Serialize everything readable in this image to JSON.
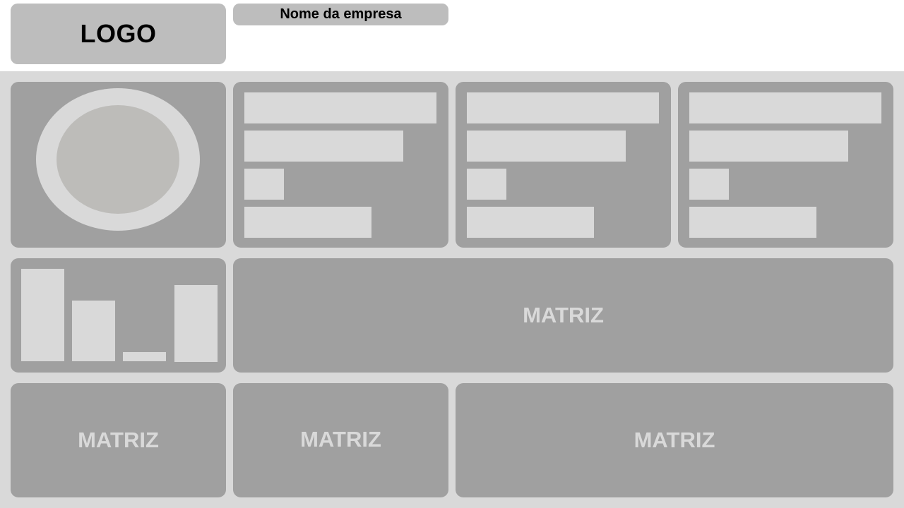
{
  "header": {
    "logo_text": "LOGO",
    "company_name": "Nome da empresa"
  },
  "panels": {
    "matrix_main": "MATRIZ",
    "matrix_bottom_left": "MATRIZ",
    "matrix_bottom_middle": "MATRIZ",
    "matrix_bottom_right": "MATRIZ"
  },
  "colors": {
    "page_background": "#ffffff",
    "content_background": "#d9d9d9",
    "card": "#a0a0a0",
    "placeholder": "#d9d9d9",
    "header_box": "#bdbdbd"
  },
  "icons": {
    "avatar": "circle-placeholder"
  }
}
